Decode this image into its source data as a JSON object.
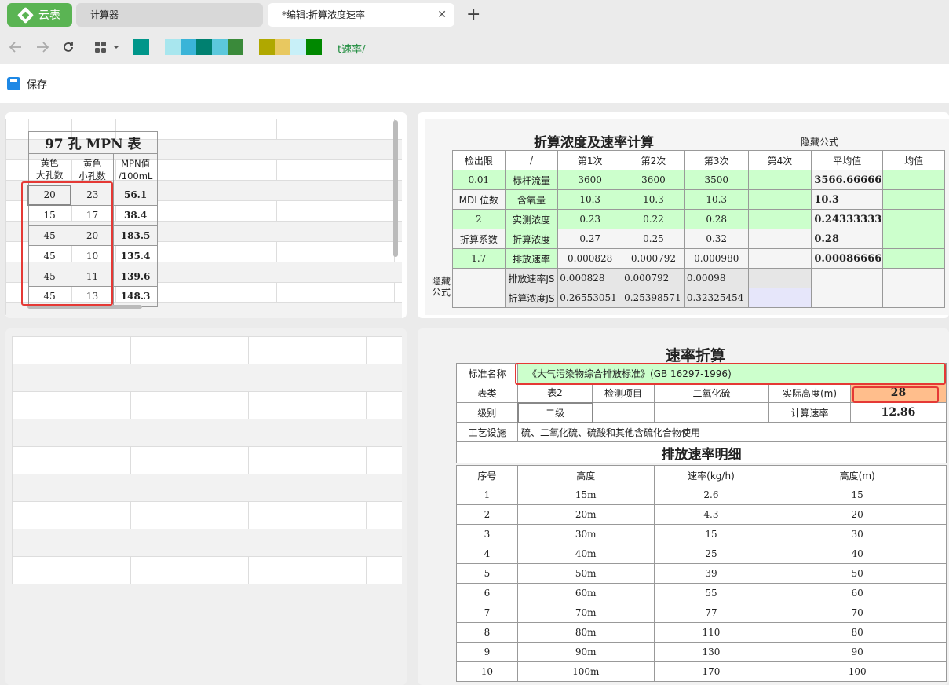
{
  "browser": {
    "brand": "云表",
    "tabs": [
      "计算器",
      "*编辑:折算浓度速率"
    ],
    "close": "✕",
    "new_tab": "+",
    "breadcrumb": "t速率/"
  },
  "toolbar": {
    "save": "保存"
  },
  "swatches": [
    "#00968a",
    "#a8e6ee",
    "#3ab4d8",
    "#008070",
    "#5cc8dc",
    "#3a8a3a",
    "#b0a800",
    "#e8c860",
    "#c8f0f8",
    "#008800"
  ],
  "mpn": {
    "title": "97 孔 MPN 表",
    "headers": [
      "黄色\n大孔数",
      "黄色\n小孔数",
      "MPN值\n/100mL"
    ],
    "rows": [
      [
        "20",
        "23",
        "56.1"
      ],
      [
        "15",
        "17",
        "38.4"
      ],
      [
        "45",
        "20",
        "183.5"
      ],
      [
        "45",
        "10",
        "135.4"
      ],
      [
        "45",
        "11",
        "139.6"
      ],
      [
        "45",
        "13",
        "148.3"
      ]
    ]
  },
  "conc": {
    "title": "折算浓度及速率计算",
    "hidden_formula": "隐藏公式",
    "side_label": "隐藏\n公式",
    "headers": [
      "检出限",
      "/",
      "第1次",
      "第2次",
      "第3次",
      "第4次",
      "平均值",
      "均值"
    ],
    "rows": [
      [
        "0.01",
        "标杆流量",
        "3600",
        "3600",
        "3500",
        "",
        "3566.66666",
        ""
      ],
      [
        "MDL位数",
        "含氧量",
        "10.3",
        "10.3",
        "10.3",
        "",
        "10.3",
        ""
      ],
      [
        "2",
        "实测浓度",
        "0.23",
        "0.22",
        "0.28",
        "",
        "0.24333333",
        ""
      ],
      [
        "折算系数",
        "折算浓度",
        "0.27",
        "0.25",
        "0.32",
        "",
        "0.28",
        ""
      ],
      [
        "1.7",
        "排放速率",
        "0.000828",
        "0.000792",
        "0.000980",
        "",
        "0.00086666",
        ""
      ],
      [
        "",
        "排放速率JS",
        "0.000828",
        "0.000792",
        "0.00098",
        "",
        "",
        ""
      ],
      [
        "",
        "折算浓度JS",
        "0.26553051",
        "0.25398571",
        "0.32325454",
        "",
        "",
        ""
      ]
    ]
  },
  "rate": {
    "title": "速率折算",
    "std_label": "标准名称",
    "std_value": "《大气污染物综合排放标准》(GB 16297-1996)",
    "type_label": "表类",
    "type_value": "表2",
    "item_label": "检测项目",
    "item_value": "二氧化硫",
    "height_label": "实际高度(m)",
    "height_value": "28",
    "level_label": "级别",
    "level_value": "二级",
    "calc_label": "计算速率",
    "calc_value": "12.86",
    "process_label": "工艺设施",
    "process_value": "硫、二氧化硫、硫酸和其他含硫化合物使用",
    "detail_title": "排放速率明细",
    "detail_headers": [
      "序号",
      "高度",
      "速率(kg/h)",
      "高度(m)"
    ],
    "detail_rows": [
      [
        "1",
        "15m",
        "2.6",
        "15"
      ],
      [
        "2",
        "20m",
        "4.3",
        "20"
      ],
      [
        "3",
        "30m",
        "15",
        "30"
      ],
      [
        "4",
        "40m",
        "25",
        "40"
      ],
      [
        "5",
        "50m",
        "39",
        "50"
      ],
      [
        "6",
        "60m",
        "55",
        "60"
      ],
      [
        "7",
        "70m",
        "77",
        "70"
      ],
      [
        "8",
        "80m",
        "110",
        "80"
      ],
      [
        "9",
        "90m",
        "130",
        "90"
      ],
      [
        "10",
        "100m",
        "170",
        "100"
      ]
    ]
  }
}
